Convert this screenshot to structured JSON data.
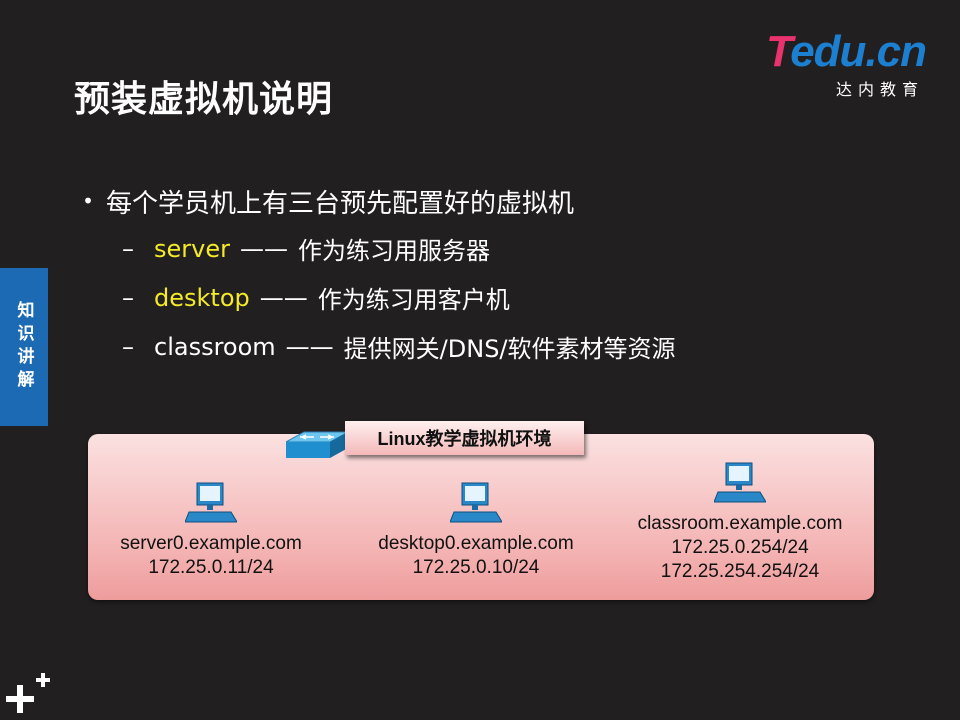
{
  "logo": {
    "brand_t": "T",
    "brand_rest": "edu.cn",
    "subtitle": "达内教育"
  },
  "title": "预装虚拟机说明",
  "side_tab": "知识讲解",
  "bullets": {
    "main": "每个学员机上有三台预先配置好的虚拟机",
    "items": [
      {
        "name": "server",
        "sep": "——",
        "desc": "作为练习用服务器",
        "highlight": true
      },
      {
        "name": "desktop",
        "sep": "——",
        "desc": "作为练习用客户机",
        "highlight": true
      },
      {
        "name": "classroom",
        "sep": "——",
        "desc": "提供网关/DNS/软件素材等资源",
        "highlight": false
      }
    ]
  },
  "network": {
    "label": "Linux教学虚拟机环境",
    "hosts": [
      {
        "hostname": "server0.example.com",
        "addresses": [
          "172.25.0.11/24"
        ],
        "icon": "computer-icon"
      },
      {
        "hostname": "desktop0.example.com",
        "addresses": [
          "172.25.0.10/24"
        ],
        "icon": "computer-icon"
      },
      {
        "hostname": "classroom.example.com",
        "addresses": [
          "172.25.0.254/24",
          "172.25.254.254/24"
        ],
        "icon": "computer-icon"
      }
    ],
    "switch_icon": "network-switch-icon"
  },
  "colors": {
    "background": "#221f20",
    "highlight": "#f3ea2a",
    "side_tab": "#1c6ab3",
    "logo_pink": "#e8336f",
    "logo_blue": "#1d7fd0"
  },
  "corner_icon": "plus-icon"
}
